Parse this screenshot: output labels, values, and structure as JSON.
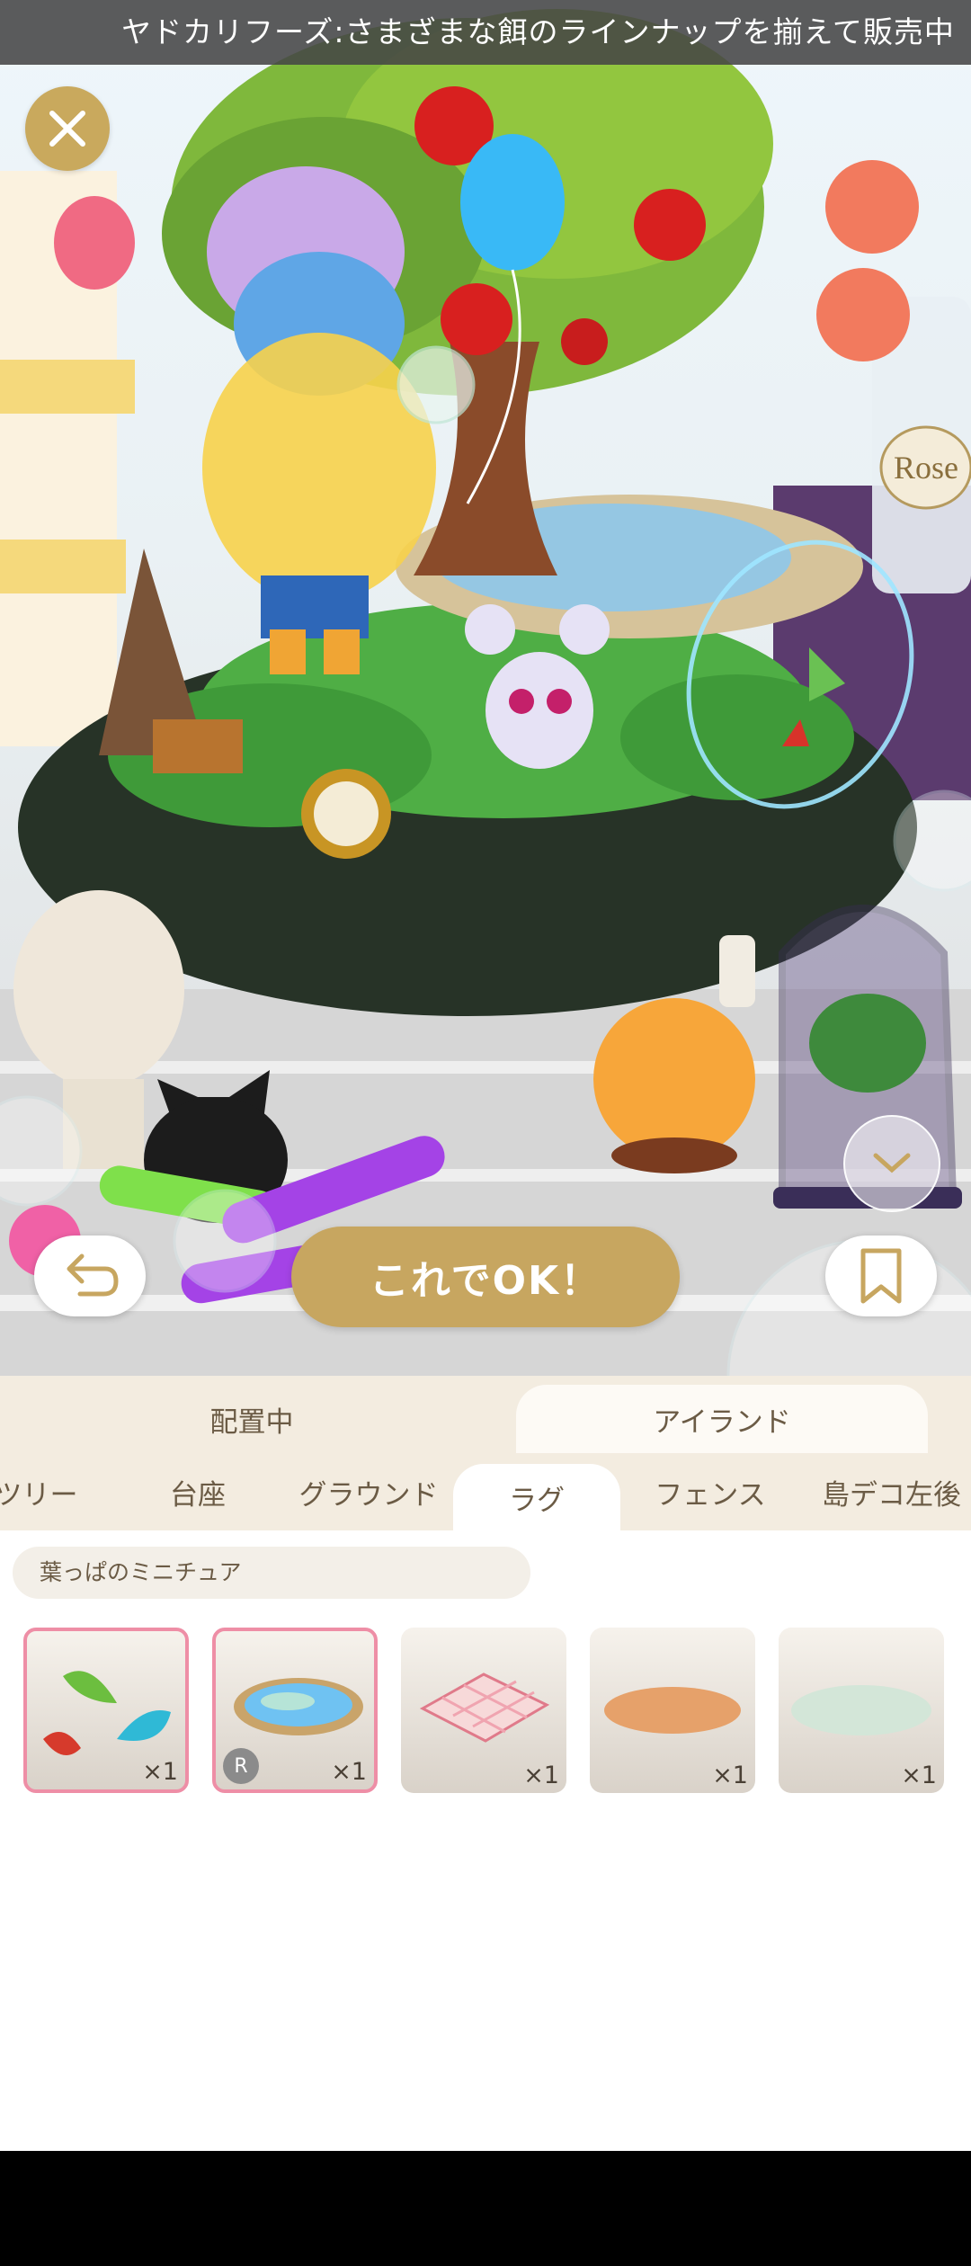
{
  "ticker": {
    "message": "ヤドカリフーズ:さまざまな餌のラインナップを揃えて販売中"
  },
  "scene": {
    "decor_label": "Rose",
    "ok_button_label": "これでOK！"
  },
  "panel": {
    "main_tabs": [
      {
        "label": "配置中",
        "active": false
      },
      {
        "label": "アイランド",
        "active": true
      }
    ],
    "sub_tabs": [
      {
        "label": "ツリー",
        "active": false
      },
      {
        "label": "台座",
        "active": false
      },
      {
        "label": "グラウンド",
        "active": false
      },
      {
        "label": "ラグ",
        "active": true
      },
      {
        "label": "フェンス",
        "active": false
      },
      {
        "label": "島デコ左後",
        "active": false
      }
    ],
    "selected_item_name": "葉っぱのミニチュア",
    "items": [
      {
        "icon": "leaf-miniature-icon",
        "count": "×1",
        "selected": true,
        "badge": ""
      },
      {
        "icon": "rainbow-puddle-rug-icon",
        "count": "×1",
        "selected": true,
        "badge": "R"
      },
      {
        "icon": "checkered-picnic-rug-icon",
        "count": "×1",
        "selected": false,
        "badge": ""
      },
      {
        "icon": "orange-oval-rug-icon",
        "count": "×1",
        "selected": false,
        "badge": ""
      },
      {
        "icon": "mint-puddle-rug-icon",
        "count": "×1",
        "selected": false,
        "badge": ""
      }
    ]
  },
  "colors": {
    "accent_gold": "#c7a660",
    "selected_border": "#ee8ea6",
    "tab_bar": "#f3ece0"
  }
}
